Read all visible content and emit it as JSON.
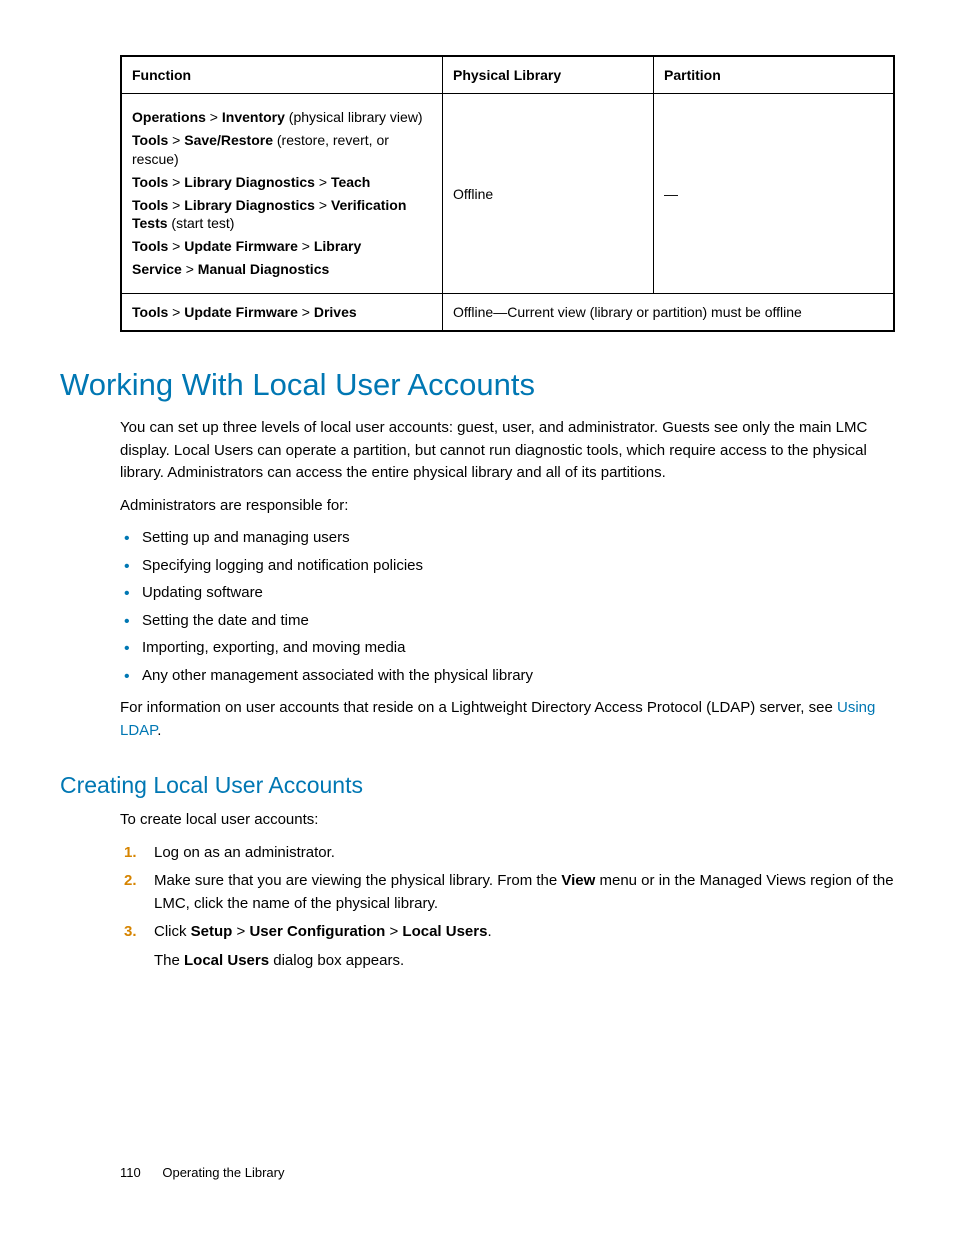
{
  "table": {
    "headers": [
      "Function",
      "Physical Library",
      "Partition"
    ],
    "row1": {
      "functions": [
        {
          "pre": "",
          "b1": "Operations",
          "mid1": " > ",
          "b2": "Inventory",
          "post": " (physical library view)"
        },
        {
          "pre": "",
          "b1": "Tools",
          "mid1": " > ",
          "b2": "Save/Restore",
          "post": " (restore, revert, or rescue)"
        },
        {
          "pre": "",
          "b1": "Tools",
          "mid1": " > ",
          "b2": "Library Diagnostics",
          "mid2": " > ",
          "b3": "Teach",
          "post": ""
        },
        {
          "pre": "",
          "b1": "Tools",
          "mid1": " > ",
          "b2": "Library Diagnostics",
          "mid2": " > ",
          "b3": "Verification Tests",
          "post": " (start test)"
        },
        {
          "pre": "",
          "b1": "Tools",
          "mid1": " > ",
          "b2": "Update Firmware",
          "mid2": " > ",
          "b3": "Library",
          "post": ""
        },
        {
          "pre": "",
          "b1": "Service",
          "mid1": " > ",
          "b2": "Manual Diagnostics",
          "post": ""
        }
      ],
      "physical": "Offline",
      "partition": "—"
    },
    "row2": {
      "func": {
        "b1": "Tools",
        "mid1": " > ",
        "b2": "Update Firmware",
        "mid2": " > ",
        "b3": "Drives"
      },
      "merged": "Offline—Current view (library or partition) must be offline"
    }
  },
  "h1": "Working With Local User Accounts",
  "intro": "You can set up three levels of local user accounts: guest, user, and administrator. Guests see only the main LMC display. Local Users can operate a partition, but cannot run diagnostic tools, which require access to the physical library. Administrators can access the entire physical library and all of its partitions.",
  "admin_intro": "Administrators are responsible for:",
  "admin_bullets": [
    "Setting up and managing users",
    "Specifying logging and notification policies",
    "Updating software",
    "Setting the date and time",
    "Importing, exporting, and moving media",
    "Any other management associated with the physical library"
  ],
  "ldap_pre": "For information on user accounts that reside on a Lightweight Directory Access Protocol (LDAP) server, see ",
  "ldap_link": "Using LDAP",
  "ldap_post": ".",
  "h2": "Creating Local User Accounts",
  "create_intro": "To create local user accounts:",
  "steps": {
    "s1": "Log on as an administrator.",
    "s2_pre": "Make sure that you are viewing the physical library. From the ",
    "s2_b": "View",
    "s2_post": " menu or in the Managed Views region of the LMC, click the name of the physical library.",
    "s3_pre": "Click ",
    "s3_b1": "Setup",
    "s3_mid1": " > ",
    "s3_b2": "User Configuration",
    "s3_mid2": " > ",
    "s3_b3": "Local Users",
    "s3_post": ".",
    "s3_line2_pre": "The ",
    "s3_line2_b": "Local Users",
    "s3_line2_post": " dialog box appears."
  },
  "footer": {
    "page": "110",
    "title": "Operating the Library"
  }
}
